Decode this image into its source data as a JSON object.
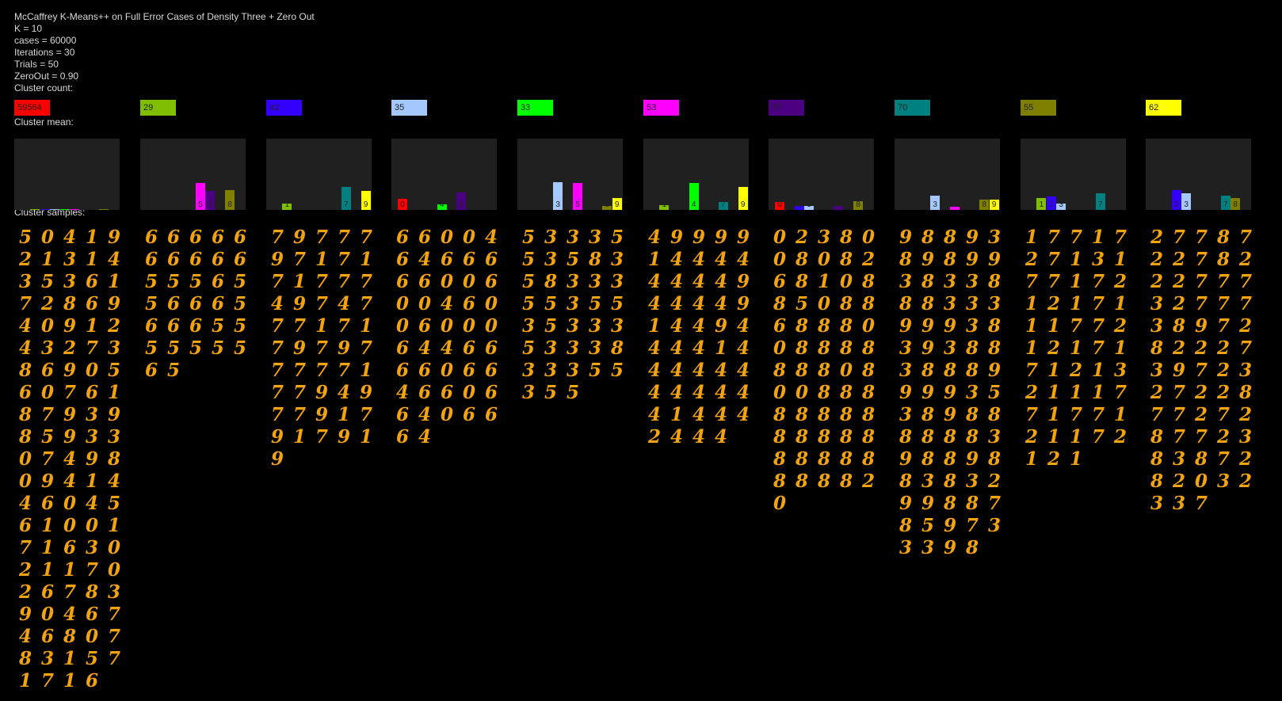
{
  "header": {
    "title": "McCaffrey K-Means++ on Full Error Cases of Density Three + Zero Out",
    "k": "K = 10",
    "cases": "cases = 60000",
    "iterations": "Iterations = 30",
    "trials": "Trials = 50",
    "zeroout": "ZeroOut = 0.90",
    "cluster_count_label": "Cluster count:",
    "cluster_mean_label": "Cluster mean:",
    "cluster_samples_label": "Cluster samples:"
  },
  "digit_colors": [
    "#ff0000",
    "#7fbf00",
    "#3300ff",
    "#a5c8ff",
    "#00ff00",
    "#ff00ff",
    "#4b0082",
    "#008080",
    "#808000",
    "#ffff00"
  ],
  "clusters": [
    {
      "count": "59564",
      "color": "#ff0000",
      "text_color": "#222222",
      "mean": [
        {
          "d": 1,
          "v": 0.01
        },
        {
          "d": 2,
          "v": 0.01
        },
        {
          "d": 3,
          "v": 0.01
        },
        {
          "d": 4,
          "v": 0.01
        },
        {
          "d": 5,
          "v": 0.01
        },
        {
          "d": 8,
          "v": 0.01
        }
      ],
      "samples": "50419213143536172869409124327386905607618793985933074980941446045610017163021170267839046746807831571716"
    },
    {
      "count": "29",
      "color": "#7fbf00",
      "text_color": "#222222",
      "mean": [
        {
          "d": 5,
          "v": 0.4
        },
        {
          "d": 6,
          "v": 0.28
        },
        {
          "d": 8,
          "v": 0.3
        }
      ],
      "samples": "66666666665556556665666555555565"
    },
    {
      "count": "42",
      "color": "#3300ff",
      "text_color": "#222222",
      "mean": [
        {
          "d": 1,
          "v": 0.1
        },
        {
          "d": 7,
          "v": 0.34
        },
        {
          "d": 9,
          "v": 0.28
        }
      ],
      "samples": "797779717171777497477717179797777717794977917917919"
    },
    {
      "count": "35",
      "color": "#a5c8ff",
      "text_color": "#222222",
      "mean": [
        {
          "d": 0,
          "v": 0.17
        },
        {
          "d": 4,
          "v": 0.08
        },
        {
          "d": 6,
          "v": 0.26
        }
      ],
      "samples": "66004646666600600460060006446666066466066406664"
    },
    {
      "count": "33",
      "color": "#00ff00",
      "text_color": "#222222",
      "mean": [
        {
          "d": 3,
          "v": 0.42
        },
        {
          "d": 5,
          "v": 0.4
        },
        {
          "d": 8,
          "v": 0.06
        },
        {
          "d": 9,
          "v": 0.18
        }
      ],
      "samples": "53335535835833355355353335333833355355"
    },
    {
      "count": "53",
      "color": "#ff00ff",
      "text_color": "#222222",
      "mean": [
        {
          "d": 1,
          "v": 0.07
        },
        {
          "d": 4,
          "v": 0.4
        },
        {
          "d": 7,
          "v": 0.12
        },
        {
          "d": 9,
          "v": 0.35
        }
      ],
      "samples": "4999914444444494444914494444144444444444414442444"
    },
    {
      "count": "57",
      "color": "#4b0082",
      "text_color": "#222222",
      "mean": [
        {
          "d": 0,
          "v": 0.12
        },
        {
          "d": 2,
          "v": 0.06
        },
        {
          "d": 3,
          "v": 0.06
        },
        {
          "d": 6,
          "v": 0.06
        },
        {
          "d": 8,
          "v": 0.13
        }
      ],
      "samples": "0238008082681088508868880088888880800888888888888888888888820"
    },
    {
      "count": "70",
      "color": "#008080",
      "text_color": "#222222",
      "mean": [
        {
          "d": 3,
          "v": 0.21
        },
        {
          "d": 5,
          "v": 0.05
        },
        {
          "d": 8,
          "v": 0.16
        },
        {
          "d": 9,
          "v": 0.15
        }
      ],
      "samples": "98893898993833888333999383938838889999353898888883988988383299887859733398"
    },
    {
      "count": "55",
      "color": "#808000",
      "text_color": "#222222",
      "mean": [
        {
          "d": 1,
          "v": 0.18
        },
        {
          "d": 2,
          "v": 0.2
        },
        {
          "d": 3,
          "v": 0.09
        },
        {
          "d": 7,
          "v": 0.25
        }
      ],
      "samples": "17717271317717212171117721217171213211177177121172121"
    },
    {
      "count": "62",
      "color": "#ffff00",
      "text_color": "#222222",
      "mean": [
        {
          "d": 2,
          "v": 0.3
        },
        {
          "d": 3,
          "v": 0.25
        },
        {
          "d": 7,
          "v": 0.22
        },
        {
          "d": 8,
          "v": 0.18
        }
      ],
      "samples": "277872278222777327773897282227397232722877272877238387282032337"
    }
  ]
}
